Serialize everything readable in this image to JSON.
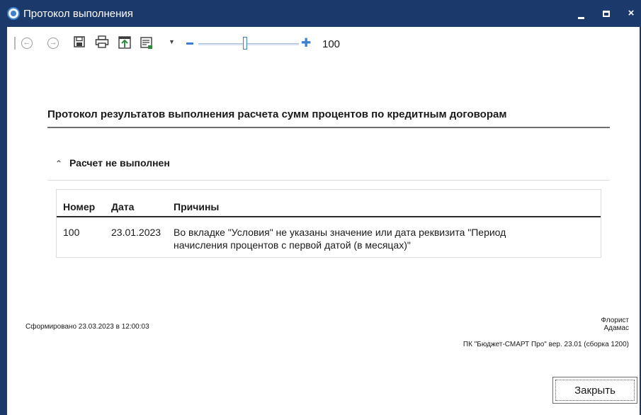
{
  "window": {
    "title": "Протокол выполнения",
    "minimize_icon": "minimize-icon",
    "maximize_icon": "maximize-icon",
    "close_glyph": "×"
  },
  "toolbar": {
    "icons": [
      "back-icon",
      "forward-icon",
      "save-icon",
      "print-icon",
      "export-icon",
      "email-icon"
    ],
    "zoom_value": "100",
    "zoom_level": 0.44
  },
  "report": {
    "title": "Протокол результатов выполнения расчета сумм процентов по кредитным договорам",
    "section_label": "Расчет не выполнен",
    "columns": [
      "Номер",
      "Дата",
      "Причины"
    ],
    "rows": [
      {
        "number": "100",
        "date": "23.01.2023",
        "reason_line1": "Во вкладке \"Условия\" не указаны значение или дата реквизита \"Период",
        "reason_line2": "начисления процентов с первой датой (в месяцах)\""
      }
    ]
  },
  "footer": {
    "generated": "Сформировано 23.03.2023 в 12:00:03",
    "user_line1": "Флорист",
    "user_line2": "Адамас",
    "product": "ПК \"Бюджет-СМАРТ Про\" вер. 23.01 (сборка 1200)"
  },
  "buttons": {
    "close_label": "Закрыть"
  },
  "colors": {
    "titlebar": "#1b3a6b",
    "accent": "#3d7fd1"
  }
}
